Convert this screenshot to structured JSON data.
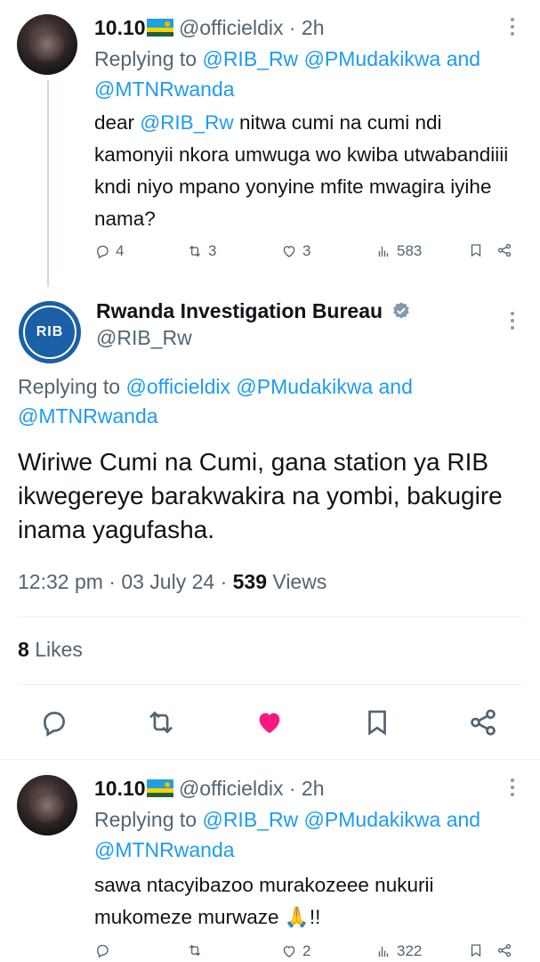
{
  "reply1": {
    "name": "10.10",
    "handle": "@officieldix",
    "time": "· 2h",
    "replying_prefix": "Replying to",
    "replying_to": [
      "@RIB_Rw",
      "@PMudakikwa"
    ],
    "replying_and": "and",
    "replying_last": "@MTNRwanda",
    "body_mention": "@RIB_Rw",
    "body_pre": "dear",
    "body_post": "nitwa cumi na cumi ndi kamonyii nkora umwuga wo kwiba utwabandiiii kndi niyo mpano yonyine mfite mwagira iyihe nama?",
    "replies": "4",
    "reposts": "3",
    "likes": "3",
    "views": "583"
  },
  "main": {
    "name": "Rwanda Investigation Bureau",
    "handle": "@RIB_Rw",
    "avatar_text": "RIB",
    "replying_prefix": "Replying to",
    "replying_to": [
      "@officieldix",
      "@PMudakikwa"
    ],
    "replying_and": "and",
    "replying_last": "@MTNRwanda",
    "body": "Wiriwe Cumi na Cumi, gana station ya RIB ikwegereye barakwakira na yombi, bakugire inama yagufasha.",
    "time": "12:32 pm · 03 July 24 ·",
    "views_count": "539",
    "views_label": "Views",
    "likes_count": "8",
    "likes_label": "Likes",
    "liked": true,
    "accent": "#1d9bf0",
    "like_color": "#f91880"
  },
  "reply2": {
    "name": "10.10",
    "handle": "@officieldix",
    "time": "· 2h",
    "replying_prefix": "Replying to",
    "replying_to": [
      "@RIB_Rw",
      "@PMudakikwa"
    ],
    "replying_and": "and",
    "replying_last": "@MTNRwanda",
    "body": "sawa ntacyibazoo murakozeee nukurii mukomeze murwaze 🙏!!",
    "likes": "2",
    "views": "322"
  }
}
